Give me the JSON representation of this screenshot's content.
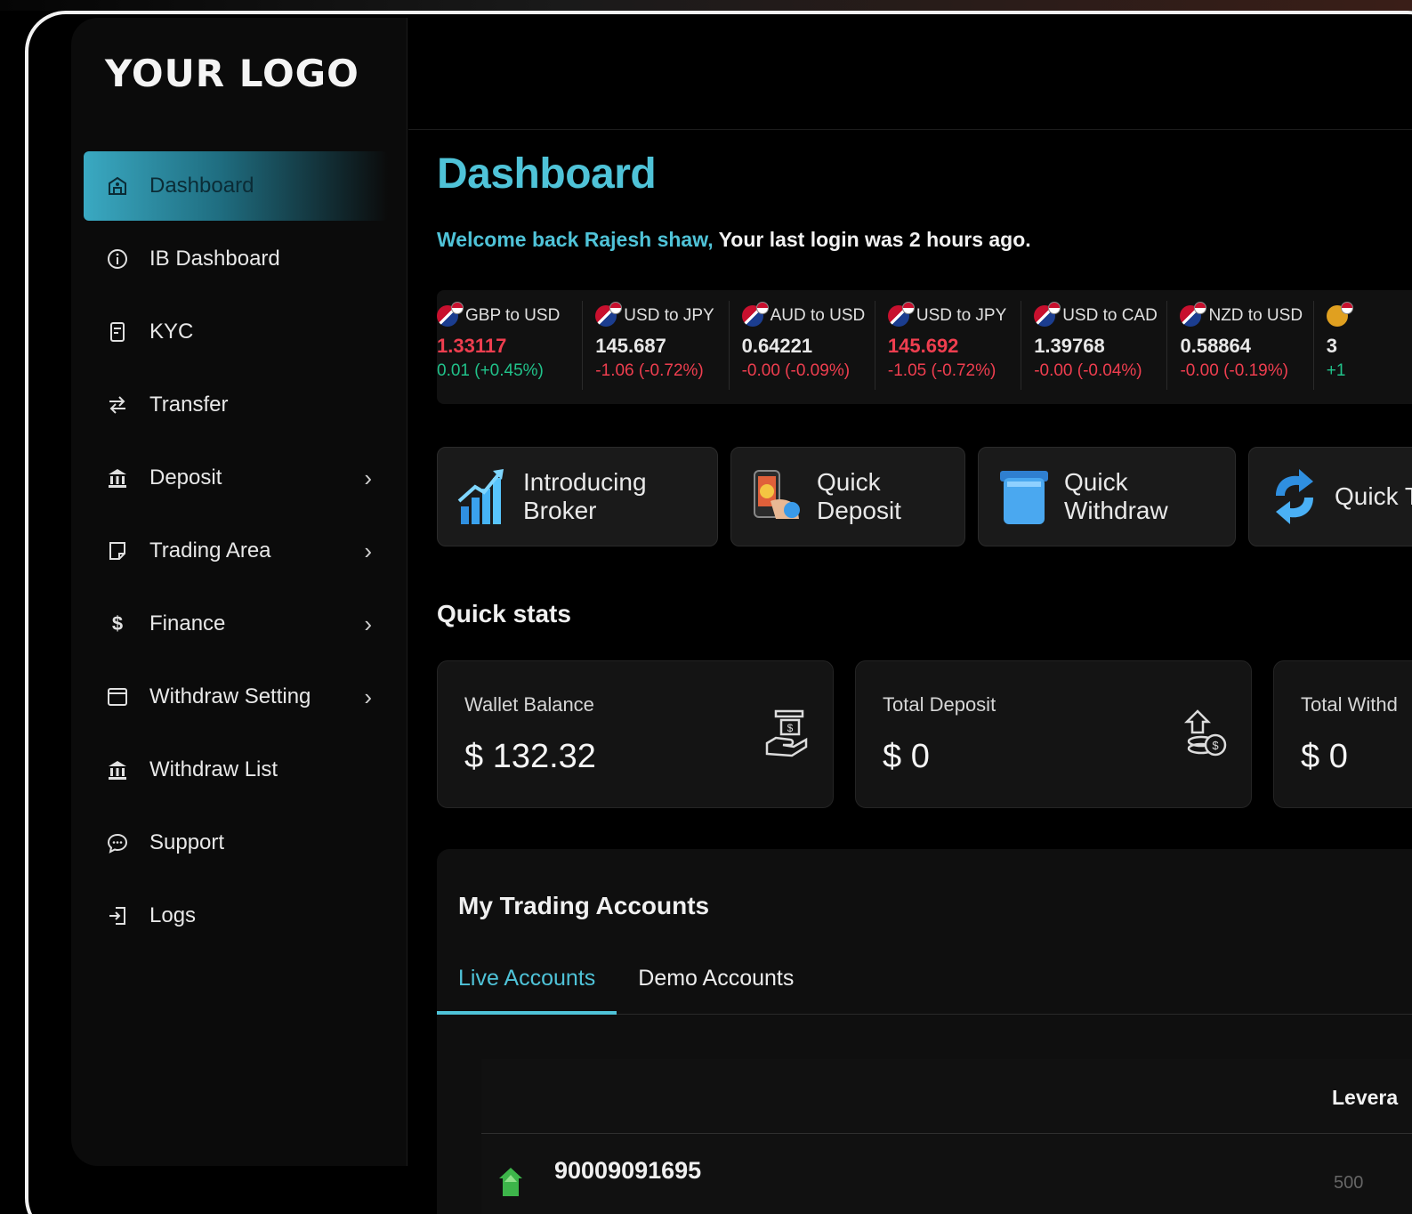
{
  "brand": {
    "logo_text": "YOUR LOGO"
  },
  "sidebar": {
    "items": [
      {
        "label": "Dashboard",
        "icon": "dashboard-icon",
        "active": true,
        "chevron": false
      },
      {
        "label": "IB Dashboard",
        "icon": "info-icon",
        "active": false,
        "chevron": false
      },
      {
        "label": "KYC",
        "icon": "document-icon",
        "active": false,
        "chevron": false
      },
      {
        "label": "Transfer",
        "icon": "transfer-icon",
        "active": false,
        "chevron": false
      },
      {
        "label": "Deposit",
        "icon": "bank-icon",
        "active": false,
        "chevron": true
      },
      {
        "label": "Trading Area",
        "icon": "note-icon",
        "active": false,
        "chevron": true
      },
      {
        "label": "Finance",
        "icon": "dollar-icon",
        "active": false,
        "chevron": true
      },
      {
        "label": "Withdraw Setting",
        "icon": "window-icon",
        "active": false,
        "chevron": true
      },
      {
        "label": "Withdraw List",
        "icon": "bank-icon",
        "active": false,
        "chevron": false
      },
      {
        "label": "Support",
        "icon": "chat-icon",
        "active": false,
        "chevron": false
      },
      {
        "label": "Logs",
        "icon": "logout-icon",
        "active": false,
        "chevron": false
      }
    ]
  },
  "header": {
    "title": "Dashboard",
    "welcome_highlight": "Welcome back Rajesh shaw,",
    "welcome_rest": "Your last login was 2 hours ago."
  },
  "ticker": [
    {
      "pair": "GBP to USD",
      "price": "1.33117",
      "price_color": "down",
      "change": "0.01 (+0.45%)",
      "change_color": "up"
    },
    {
      "pair": "USD to JPY",
      "price": "145.687",
      "price_color": "plain",
      "change": "-1.06 (-0.72%)",
      "change_color": "down"
    },
    {
      "pair": "AUD to USD",
      "price": "0.64221",
      "price_color": "plain",
      "change": "-0.00 (-0.09%)",
      "change_color": "down"
    },
    {
      "pair": "USD to JPY",
      "price": "145.692",
      "price_color": "down",
      "change": "-1.05 (-0.72%)",
      "change_color": "down"
    },
    {
      "pair": "USD to CAD",
      "price": "1.39768",
      "price_color": "plain",
      "change": "-0.00 (-0.04%)",
      "change_color": "down"
    },
    {
      "pair": "NZD to USD",
      "price": "0.58864",
      "price_color": "plain",
      "change": "-0.00 (-0.19%)",
      "change_color": "down"
    },
    {
      "pair": "",
      "price": "3",
      "price_color": "plain",
      "change": "+1",
      "change_color": "up"
    }
  ],
  "quick_actions": [
    {
      "label": "Introducing Broker",
      "icon": "growth-chart-icon"
    },
    {
      "label": "Quick Deposit",
      "icon": "mobile-deposit-icon"
    },
    {
      "label": "Quick Withdraw",
      "icon": "withdraw-icon"
    },
    {
      "label": "Quick T",
      "icon": "transfer-arrows-icon"
    }
  ],
  "quick_stats": {
    "heading": "Quick stats",
    "cards": [
      {
        "label": "Wallet Balance",
        "value": "$ 132.32",
        "icon": "money-hand-icon"
      },
      {
        "label": "Total Deposit",
        "value": "$ 0",
        "icon": "deposit-coins-icon"
      },
      {
        "label": "Total Withd",
        "value": "$ 0",
        "icon": ""
      }
    ]
  },
  "trading_accounts": {
    "title": "My Trading Accounts",
    "tabs": [
      {
        "label": "Live Accounts",
        "active": true
      },
      {
        "label": "Demo Accounts",
        "active": false
      }
    ],
    "columns": {
      "leverage": "Levera"
    },
    "rows": [
      {
        "account_number": "90009091695",
        "leverage": "500"
      }
    ]
  },
  "colors": {
    "accent": "#4fc3d8",
    "up": "#21c28a",
    "down": "#ef3e4f",
    "background": "#000000"
  }
}
